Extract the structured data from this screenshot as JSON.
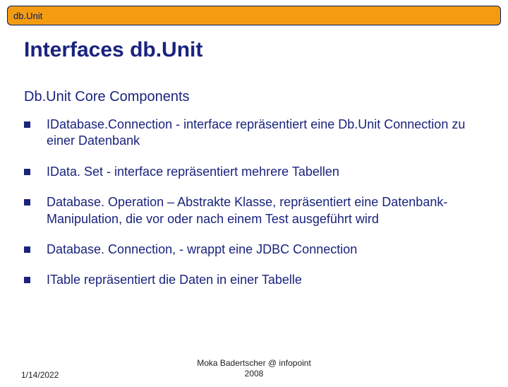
{
  "header": {
    "label": "db.Unit"
  },
  "title": "Interfaces db.Unit",
  "section": "Db.Unit Core Components",
  "bullets": [
    {
      "term": "IDatabase.Connection",
      "rest": " - interface repräsentiert eine Db.Unit Connection zu einer Datenbank"
    },
    {
      "term": "IData. Set",
      "rest": " - interface repräsentiert mehrere Tabellen"
    },
    {
      "term": "Database. Operation",
      "rest": " – Abstrakte Klasse, repräsentiert eine Datenbank-Manipulation, die vor oder nach einem Test ausgeführt wird"
    },
    {
      "term": "Database. Connection,",
      "rest": " - wrappt eine JDBC Connection"
    },
    {
      "term": "ITable",
      "rest": " repräsentiert die Daten in einer Tabelle"
    }
  ],
  "footer": {
    "date": "1/14/2022",
    "center_line1": "Moka Badertscher @ infopoint",
    "center_line2": "2008"
  }
}
